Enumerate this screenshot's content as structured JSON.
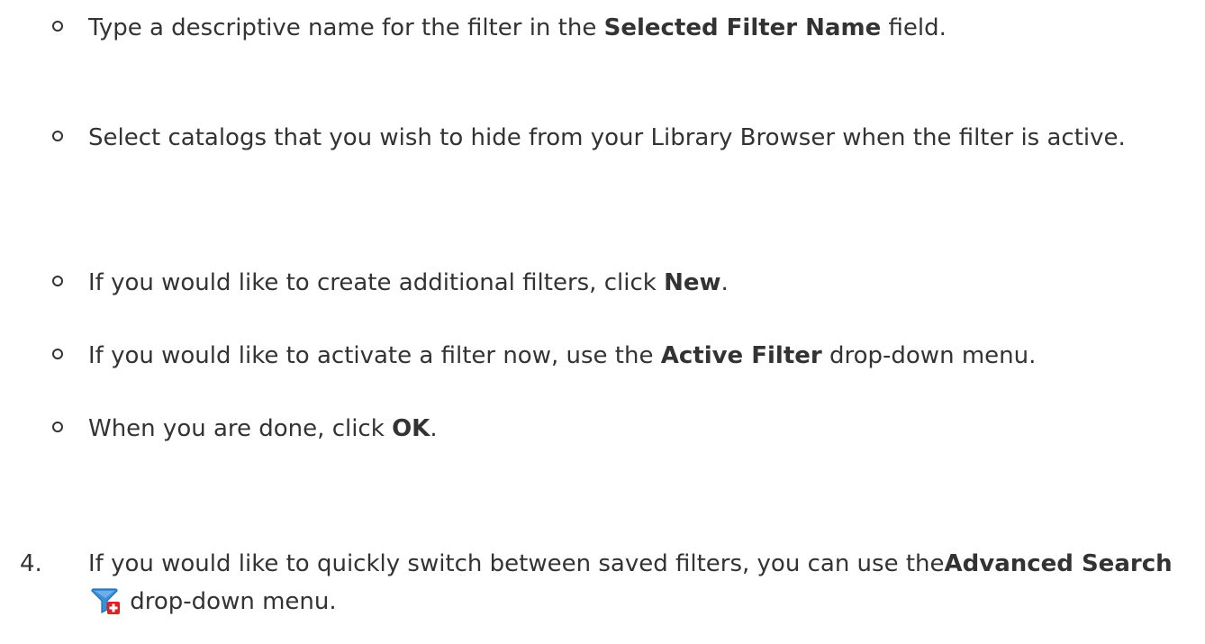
{
  "sub_items": [
    {
      "pre": "Type a descriptive name for the filter in the ",
      "bold": "Selected Filter Name",
      "post": " field."
    },
    {
      "pre": "Select catalogs that you wish to hide from your Library Browser when the filter is active.",
      "bold": "",
      "post": ""
    },
    {
      "pre": "If you would like to create additional filters, click ",
      "bold": "New",
      "post": "."
    },
    {
      "pre": "If you would like to activate a filter now, use the ",
      "bold": "Active Filter",
      "post": " drop-down menu."
    },
    {
      "pre": "When you are done, click ",
      "bold": "OK",
      "post": "."
    }
  ],
  "step4": {
    "number": "4.",
    "pre": "If you would like to quickly switch between saved filters, you can use the",
    "bold": "Advanced Search",
    "icon": "advanced-search-filter-icon",
    "post": " drop-down menu."
  },
  "colors": {
    "text": "#333333",
    "icon_funnel": "#3a8fd8",
    "icon_plus": "#e02020"
  }
}
